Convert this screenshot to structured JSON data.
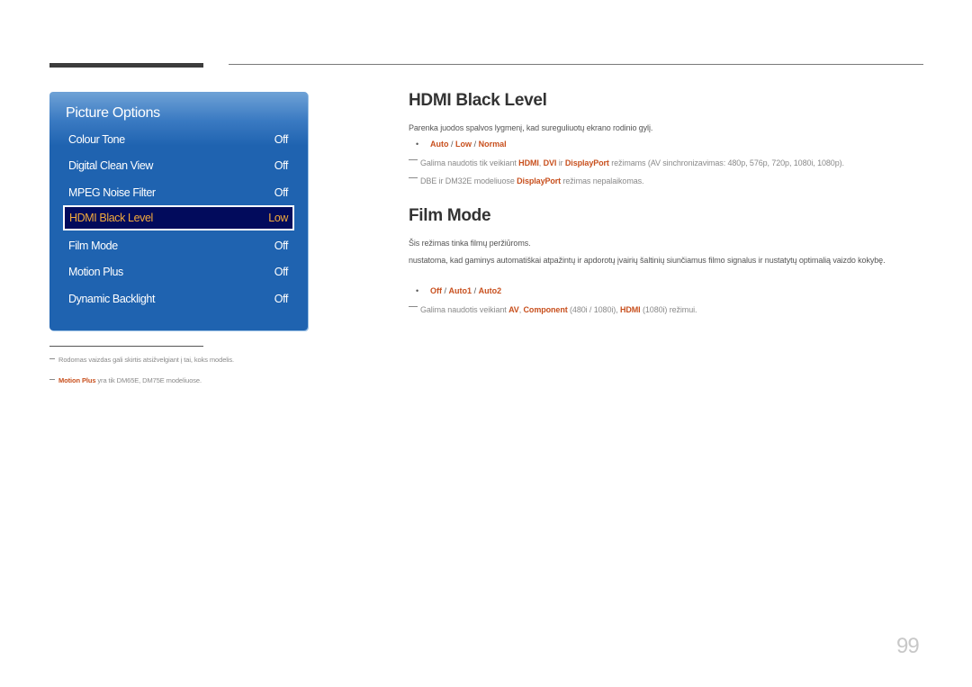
{
  "menu": {
    "title": "Picture Options",
    "items": [
      {
        "label": "Colour Tone",
        "value": "Off"
      },
      {
        "label": "Digital Clean View",
        "value": "Off"
      },
      {
        "label": "MPEG Noise Filter",
        "value": "Off"
      },
      {
        "label": "HDMI Black Level",
        "value": "Low",
        "selected": true
      },
      {
        "label": "Film Mode",
        "value": "Off"
      },
      {
        "label": "Motion Plus",
        "value": "Off"
      },
      {
        "label": "Dynamic Backlight",
        "value": "Off"
      }
    ],
    "colors": {
      "panel": "#1f63b0",
      "selected_bg": "#020b5c",
      "selected_text": "#f2a93b"
    }
  },
  "sections": {
    "hdmi": {
      "title": "HDMI Black Level",
      "description": "Parenka juodos spalvos lygmenį, kad sureguliuotų ekrano rodinio gylį.",
      "options": [
        "Auto",
        "Low",
        "Normal"
      ],
      "note1": {
        "prefix": "Galima naudotis tik veikiant",
        "hl1": "HDMI",
        "comma": ",",
        "hl2": "DVI",
        "mid": "ir",
        "hl3": "DisplayPort",
        "suffix": "režimams (AV sinchronizavimas: 480p, 576p, 720p, 1080i, 1080p)."
      },
      "note2": {
        "prefix": "DBE ir DM32E modeliuose",
        "hl1": "DisplayPort",
        "suffix": "režimas nepalaikomas."
      }
    },
    "film": {
      "title": "Film Mode",
      "description1": "Šis režimas tinka filmų peržiūroms.",
      "description2": "nustatoma, kad gaminys automatiškai atpažintų ir apdorotų įvairių šaltinių siunčiamus filmo signalus ir nustatytų optimalią vaizdo kokybę.",
      "options": [
        "Off",
        "Auto1",
        "Auto2"
      ],
      "note1": {
        "prefix": "Galima naudotis veikiant",
        "hl1": "AV",
        "comma": ",",
        "hl2": "Component",
        "mid": "(480i / 1080i),",
        "hl3": "HDMI",
        "suffix": "(1080i) režimui."
      }
    }
  },
  "footnotes": {
    "f1": "Rodomas vaizdas gali skirtis atsižvelgiant į tai, koks modelis.",
    "f2_hl": "Motion Plus",
    "f2_rest": "yra tik DM65E, DM75E modeliuose."
  },
  "option_separator": "/",
  "bullet": "•",
  "page_number": "99",
  "accent_color": "#c8501e"
}
